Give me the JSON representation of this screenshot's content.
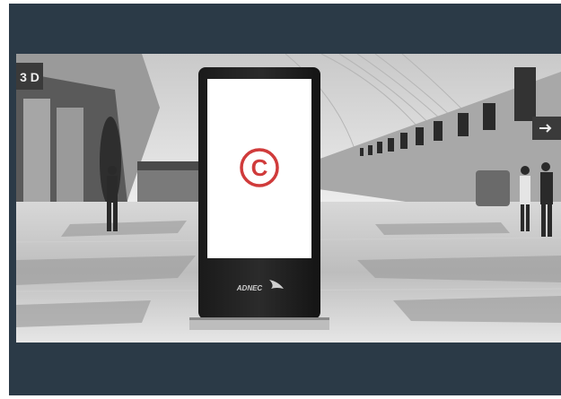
{
  "frame": {
    "border_color": "#2b3a47"
  },
  "scene": {
    "kind": "photo",
    "description_icon": "airport-concourse-photo"
  },
  "kiosk": {
    "screen_symbol": "©",
    "screen_symbol_color": "#d03b3b",
    "brand_label": "ADNEC",
    "brand_icon": "falcon-logo-icon"
  },
  "wall_sign": {
    "text": "3 D"
  }
}
